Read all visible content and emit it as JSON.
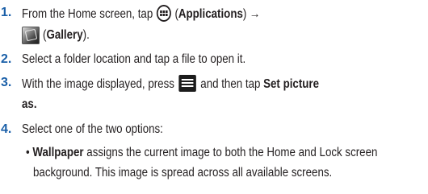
{
  "steps": [
    {
      "number": "1.",
      "pre": "From the Home screen, tap",
      "apps_label": "Applications",
      "arrow": "→",
      "gallery_label": "Gallery"
    },
    {
      "number": "2.",
      "text": "Select a folder location and tap a file to open it."
    },
    {
      "number": "3.",
      "pre": "With the image displayed, press",
      "mid": "and then tap",
      "action": "Set picture",
      "action_cont": "as."
    },
    {
      "number": "4.",
      "text": "Select one of the two options:"
    }
  ],
  "bullet": {
    "symbol": "•",
    "term": "Wallpaper",
    "line1": "assigns the current image to both the Home and Lock screen",
    "line2": "background. This image is spread across all available screens."
  },
  "icons": {
    "apps": "applications-grid-icon",
    "gallery": "gallery-app-icon",
    "menu": "menu-key-icon"
  },
  "colors": {
    "step_number": "#1a5fa8",
    "text": "#231f20"
  }
}
